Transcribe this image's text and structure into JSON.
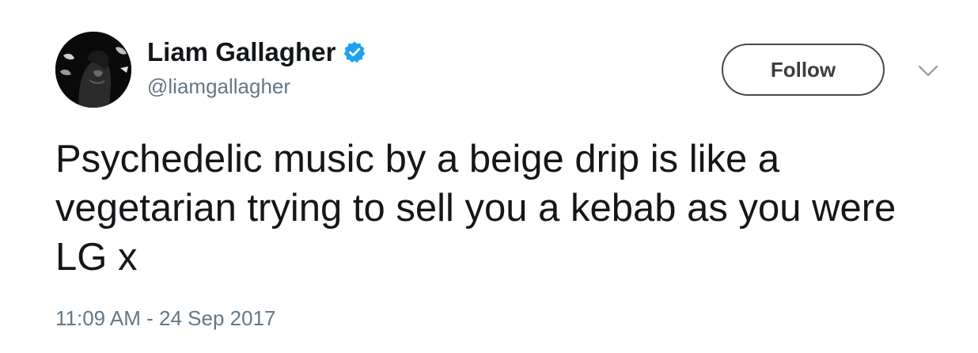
{
  "author": {
    "display_name": "Liam Gallagher",
    "handle": "@liamgallagher",
    "verified": true,
    "avatar_icon": "profile-photo"
  },
  "actions": {
    "follow_label": "Follow",
    "menu_icon": "chevron-down-icon"
  },
  "tweet": {
    "text": "Psychedelic music by a beige drip is like a vegetarian trying to sell you a kebab as you were LG x",
    "timestamp": "11:09 AM - 24 Sep 2017"
  },
  "colors": {
    "text_primary": "#14171a",
    "text_secondary": "#657786",
    "verified_blue": "#1da1f2",
    "button_border": "#4a4a4a"
  }
}
